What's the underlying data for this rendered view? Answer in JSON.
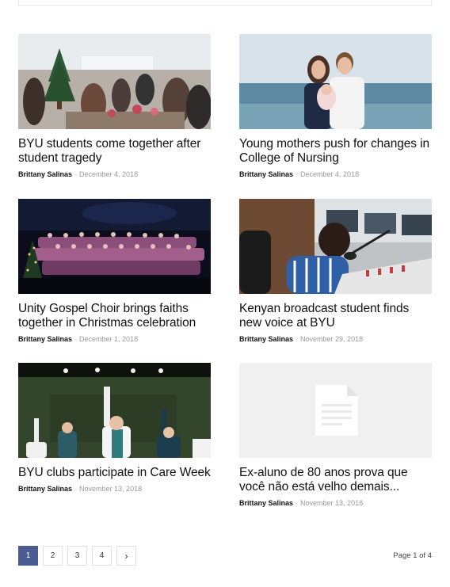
{
  "articles": [
    {
      "title": "BYU students come together after student tragedy",
      "author": "Brittany Salinas",
      "separator": "-",
      "date": "December 4, 2018"
    },
    {
      "title": "Young mothers push for changes in College of Nursing",
      "author": "Brittany Salinas",
      "separator": "-",
      "date": "December 4, 2018"
    },
    {
      "title": "Unity Gospel Choir brings faiths together in Christmas celebration",
      "author": "Brittany Salinas",
      "separator": "-",
      "date": "December 1, 2018"
    },
    {
      "title": "Kenyan broadcast student finds new voice at BYU",
      "author": "Brittany Salinas",
      "separator": "-",
      "date": "November 29, 2018"
    },
    {
      "title": "BYU clubs participate in Care Week",
      "author": "Brittany Salinas",
      "separator": "-",
      "date": "November 13, 2018"
    },
    {
      "title": "Ex-aluno de 80 anos prova que você não está velho demais...",
      "author": "Brittany Salinas",
      "separator": "-",
      "date": "November 13, 2018"
    }
  ],
  "pagination": {
    "pages": [
      "1",
      "2",
      "3",
      "4"
    ],
    "current": "1",
    "next_icon": "›",
    "info": "Page 1 of 4"
  },
  "colors": {
    "accent": "#4a5d92"
  }
}
